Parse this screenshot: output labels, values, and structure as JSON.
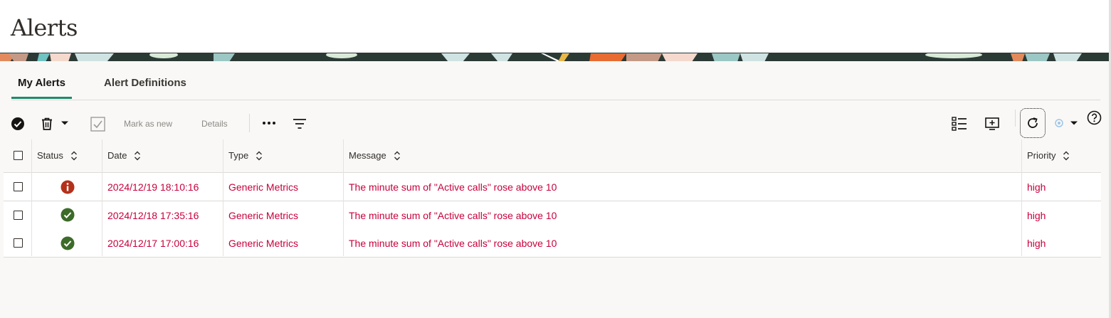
{
  "page": {
    "title": "Alerts"
  },
  "tabs": [
    {
      "label": "My Alerts",
      "active": true
    },
    {
      "label": "Alert Definitions",
      "active": false
    }
  ],
  "toolbar": {
    "mark_as_new": "Mark as new",
    "details": "Details",
    "icons": {
      "select_all": "check-circle-icon",
      "delete": "trash-icon",
      "delete_menu": "chevron-down-icon",
      "acknowledge": "checkbox-check-icon",
      "more": "ellipsis-icon",
      "filter": "filter-icon",
      "list_view": "list-view-icon",
      "add_to_dashboard": "monitor-plus-icon",
      "refresh": "refresh-icon",
      "auto_refresh": "auto-refresh-icon",
      "help": "help-icon"
    }
  },
  "table": {
    "columns": [
      "Status",
      "Date",
      "Type",
      "Message",
      "Priority"
    ],
    "rows": [
      {
        "status": "open",
        "date": "2024/12/19 18:10:16",
        "type": "Generic Metrics",
        "message": "The minute sum of \"Active calls\" rose above 10",
        "priority": "high"
      },
      {
        "status": "resolved",
        "date": "2024/12/18 17:35:16",
        "type": "Generic Metrics",
        "message": "The minute sum of \"Active calls\" rose above 10",
        "priority": "high"
      },
      {
        "status": "resolved",
        "date": "2024/12/17 17:00:16",
        "type": "Generic Metrics",
        "message": "The minute sum of \"Active calls\" rose above 10",
        "priority": "high"
      }
    ]
  },
  "colors": {
    "accent": "#1e8a6d",
    "alert_text": "#c7003c",
    "status_open": "#b3311b",
    "status_resolved": "#3d6b2a"
  }
}
